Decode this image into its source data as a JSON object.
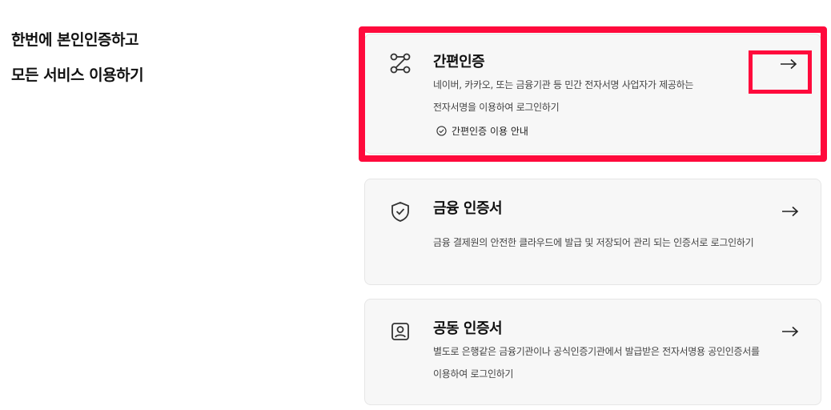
{
  "headline": {
    "line1": "한번에 본인인증하고",
    "line2": "모든 서비스 이용하기"
  },
  "cards": {
    "simple": {
      "icon": "route-icon",
      "title": "간편인증",
      "desc_line1": "네이버, 카카오, 또는 금융기관 등 민간 전자서명 사업자가 제공하는",
      "desc_line2": "전자서명을 이용하여 로그인하기",
      "guide_label": "간편인증 이용 안내"
    },
    "finance": {
      "icon": "shield-check-icon",
      "title": "금융 인증서",
      "desc_line1": "금융 결제원의 안전한 클라우드에 발급 및 저장되어 관리 되는 인증서로 로그인하기"
    },
    "joint": {
      "icon": "id-card-icon",
      "title": "공동 인증서",
      "desc_line1": "별도로 은행같은 금융기관이나 공식인증기관에서 발급받은 전자서명용 공인인증서를",
      "desc_line2": "이용하여 로그인하기"
    }
  },
  "colors": {
    "highlight": "#ff0a3c",
    "card_bg": "#f7f7f7"
  }
}
